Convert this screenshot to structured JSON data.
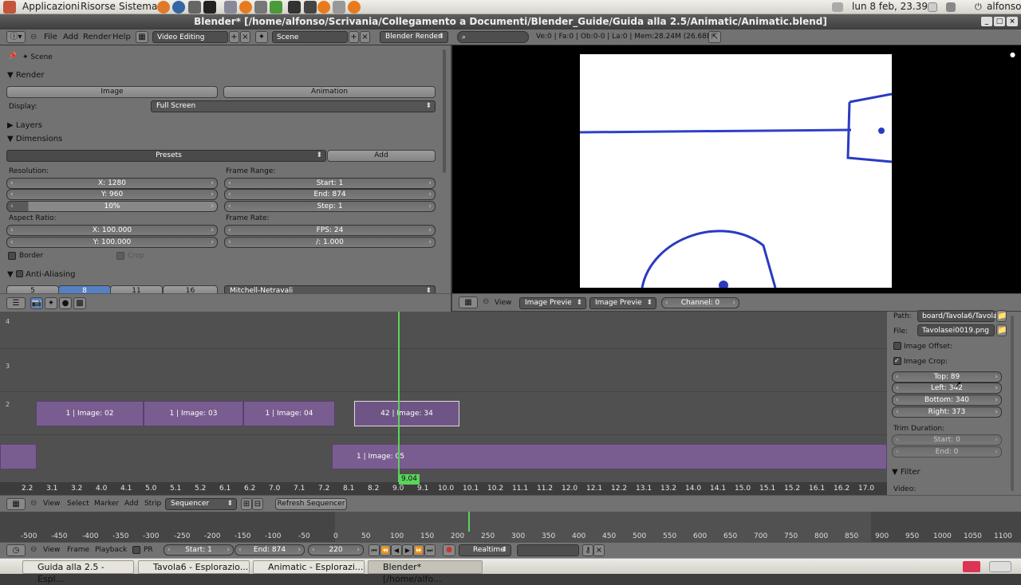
{
  "gnome": {
    "apps": "Applicazioni",
    "places": "Risorse",
    "system": "Sistema",
    "clock": "lun  8 feb, 23.39",
    "user": "alfonso"
  },
  "window": {
    "title": "Blender* [/home/alfonso/Scrivania/Collegamento a Documenti/Blender_Guide/Guida alla 2.5/Animatic/Animatic.blend]"
  },
  "header": {
    "menus": [
      "File",
      "Add",
      "Render",
      "Help"
    ],
    "layout": "Video Editing",
    "scene": "Scene",
    "engine": "Blender Render",
    "stats": "Ve:0 | Fa:0 | Ob:0-0 | La:0 | Mem:28.24M (26.68M)"
  },
  "props": {
    "scene_label": "Scene",
    "render_title": "Render",
    "image_btn": "Image",
    "animation_btn": "Animation",
    "display_label": "Display:",
    "display_value": "Full Screen",
    "layers": "Layers",
    "dimensions": "Dimensions",
    "presets": "Presets",
    "add": "Add",
    "resolution": "Resolution:",
    "res_x": "X: 1280",
    "res_y": "Y: 960",
    "res_pct": "10%",
    "frame_range": "Frame Range:",
    "start": "Start: 1",
    "end": "End: 874",
    "step": "Step: 1",
    "aspect": "Aspect Ratio:",
    "asp_x": "X: 100.000",
    "asp_y": "Y: 100.000",
    "frame_rate": "Frame Rate:",
    "fps": "FPS: 24",
    "base": "/: 1.000",
    "border": "Border",
    "crop": "Crop",
    "aa": "Anti-Aliasing",
    "aa_vals": [
      "5",
      "8",
      "11",
      "16"
    ],
    "filter": "Mitchell-Netravali"
  },
  "preview_header": {
    "view": "View",
    "mode1": "Image Previe",
    "mode2": "Image Previe",
    "channel": "Channel: 0"
  },
  "sequencer": {
    "strips": [
      {
        "label": "1 | Image: 02"
      },
      {
        "label": "1 | Image: 03"
      },
      {
        "label": "1 | Image: 04"
      },
      {
        "label": "42 | Image: 34"
      },
      {
        "label": "1 | Image: 05"
      }
    ],
    "ticks": [
      "2.2",
      "3.1",
      "3.2",
      "4.0",
      "4.1",
      "5.0",
      "5.1",
      "5.2",
      "6.1",
      "6.2",
      "7.0",
      "7.1",
      "7.2",
      "8.1",
      "8.2",
      "9.0",
      "9.1",
      "10.0",
      "10.1",
      "10.2",
      "11.1",
      "11.2",
      "12.0",
      "12.1",
      "12.2",
      "13.1",
      "13.2",
      "14.0",
      "14.1",
      "15.0",
      "15.1",
      "15.2",
      "16.1",
      "16.2",
      "17.0"
    ],
    "current": "9.04",
    "channels": [
      "4",
      "3",
      "2"
    ]
  },
  "side": {
    "path_label": "Path:",
    "path_value": "board/Tavola6/Tavola6/",
    "file_label": "File:",
    "file_value": "Tavolasei0019.png",
    "offset": "Image Offset:",
    "crop": "Image Crop:",
    "top": "Top: 89",
    "left": "Left: 342",
    "bottom": "Bottom: 340",
    "right": "Right: 373",
    "trim": "Trim Duration:",
    "trim_start": "Start: 0",
    "trim_end": "End: 0",
    "filter": "Filter",
    "video": "Video:"
  },
  "seq_header": {
    "menus": [
      "View",
      "Select",
      "Marker",
      "Add",
      "Strip"
    ],
    "mode": "Sequencer",
    "refresh": "Refresh Sequencer"
  },
  "timeline": {
    "ticks": [
      "-500",
      "-450",
      "-400",
      "-350",
      "-300",
      "-250",
      "-200",
      "-150",
      "-100",
      "-50",
      "0",
      "50",
      "100",
      "150",
      "200",
      "250",
      "300",
      "350",
      "400",
      "450",
      "500",
      "550",
      "600",
      "650",
      "700",
      "750",
      "800",
      "850",
      "900",
      "950",
      "1000",
      "1050",
      "1100"
    ]
  },
  "tl_header": {
    "menus": [
      "View",
      "Frame",
      "Playback"
    ],
    "pr": "PR",
    "start": "Start: 1",
    "end": "End: 874",
    "frame": "220",
    "realtime": "Realtime"
  },
  "taskbar": [
    "Guida alla 2.5 - Espl...",
    "Tavola6 - Esplorazio...",
    "Animatic - Esplorazi...",
    "Blender* [/home/alfo..."
  ]
}
